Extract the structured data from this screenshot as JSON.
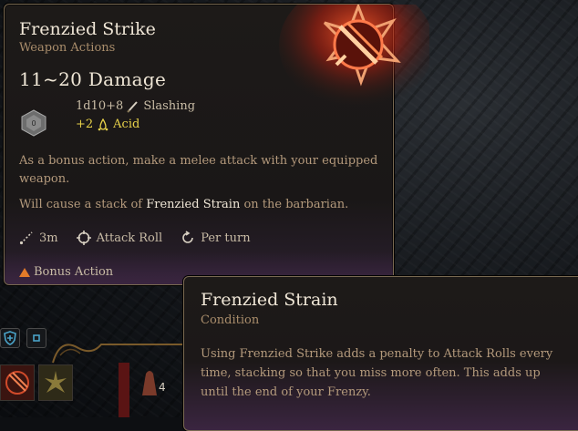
{
  "main_tooltip": {
    "title": "Frenzied Strike",
    "subtitle": "Weapon Actions",
    "damage_range": "11~20 Damage",
    "damage_roll": "1d10+8",
    "damage_type": "Slashing",
    "bonus_damage": "+2",
    "bonus_type": "Acid",
    "description": "As a bonus action, make a melee attack with your equipped weapon.",
    "effect_prefix": "Will cause a stack of ",
    "effect_highlight": "Frenzied Strain",
    "effect_suffix": " on the barbarian.",
    "properties": [
      {
        "label": "3m",
        "icon": "range-icon"
      },
      {
        "label": "Attack Roll",
        "icon": "crosshair-icon"
      },
      {
        "label": "Per turn",
        "icon": "recharge-icon"
      }
    ],
    "action_cost": "Bonus Action"
  },
  "condition_tooltip": {
    "title": "Frenzied Strain",
    "subtitle": "Condition",
    "description": "Using Frenzied Strike adds a penalty to Attack Rolls every time, stacking so that you miss more often. This adds up until the end of your Frenzy."
  },
  "hotbar": {
    "slot_count": "4"
  },
  "colors": {
    "title": "#efe6d6",
    "subtitle": "#a98d6b",
    "acid": "#e8d24a",
    "bonus_action": "#e37b29",
    "skill_glow": "#e0421e"
  }
}
